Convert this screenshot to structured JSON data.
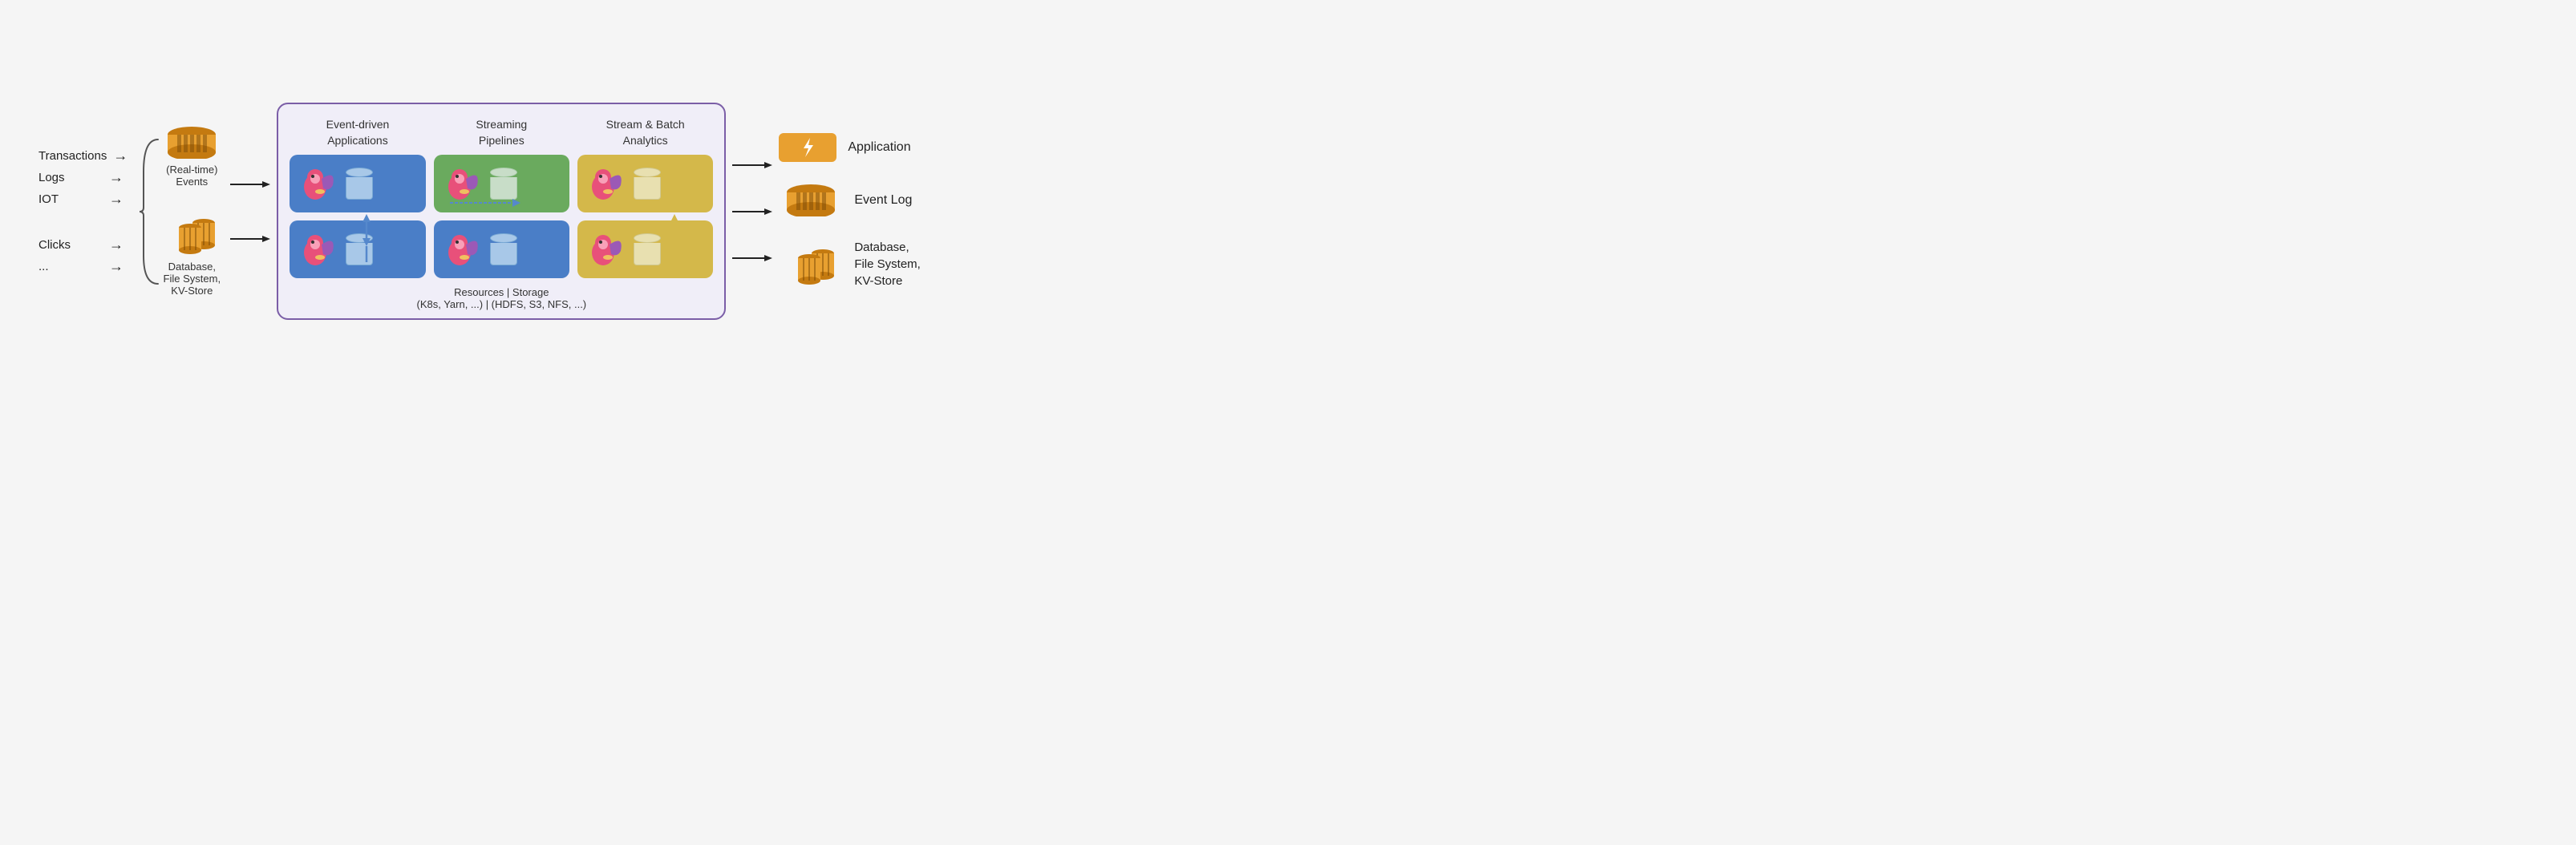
{
  "inputs": {
    "items": [
      {
        "label": "Transactions"
      },
      {
        "label": "Logs"
      },
      {
        "label": "IOT"
      },
      {
        "label": "Clicks"
      },
      {
        "label": "..."
      }
    ]
  },
  "sources": {
    "events_label": "(Real-time)\nEvents",
    "database_label": "Database,\nFile System,\nKV-Store"
  },
  "column_headers": {
    "col1": "Event-driven\nApplications",
    "col2": "Streaming\nPipelines",
    "col3": "Stream & Batch\nAnalytics"
  },
  "flink_bottom": "Resources | Storage\n(K8s, Yarn, ...) | (HDFS, S3, NFS, ...)",
  "outputs": {
    "items": [
      {
        "label": "Application"
      },
      {
        "label": "Event Log"
      },
      {
        "label": "Database,\nFile System,\nKV-Store"
      }
    ]
  }
}
